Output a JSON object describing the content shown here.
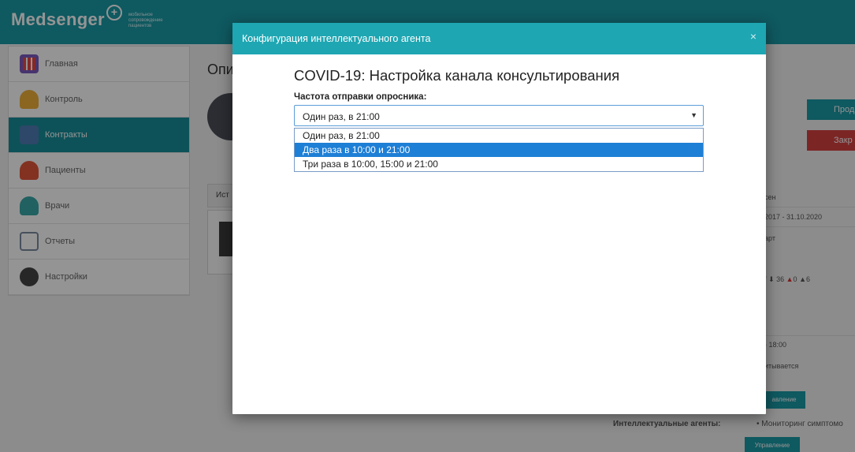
{
  "app": {
    "logo": "Medsenger",
    "tagline": "мобильное сопровождение пациентов",
    "page_title": "Опи",
    "tab_label": "Ист",
    "go_button": "Прод",
    "close_button": "Закр"
  },
  "sidebar": {
    "items": [
      {
        "label": "Главная"
      },
      {
        "label": "Контроль"
      },
      {
        "label": "Контракты"
      },
      {
        "label": "Пациенты"
      },
      {
        "label": "Врачи"
      },
      {
        "label": "Отчеты"
      },
      {
        "label": "Настройки"
      }
    ]
  },
  "info": {
    "status": "сен",
    "period": "2017 - 31.10.2020",
    "tariff": "арт",
    "stats": {
      "sep1": "/",
      "msgs": "36",
      "warn": "0",
      "alerts": "6"
    },
    "hours": "- 18:00",
    "counted": "итывается",
    "manage_label_1": "авление",
    "agents_label": "Интеллектуальные агенты:",
    "agents_value": "Мониторинг симптомо",
    "manage_label_2": "Управление"
  },
  "modal": {
    "title": "Конфигурация интеллектуального агента",
    "close_icon": "×",
    "heading": "COVID-19: Настройка канала консультирования",
    "field_label": "Частота отправки опросника:",
    "selected_value": "Один раз, в 21:00",
    "options": [
      {
        "label": "Один раз, в 21:00"
      },
      {
        "label": "Два раза в 10:00 и 21:00"
      },
      {
        "label": "Три раза в 10:00, 15:00 и 21:00"
      }
    ],
    "highlighted_option_index": 1
  },
  "colors": {
    "brand": "#1a9aa6",
    "modal_header": "#1ea6b2",
    "highlight": "#1e7fd6",
    "danger": "#d64040"
  }
}
